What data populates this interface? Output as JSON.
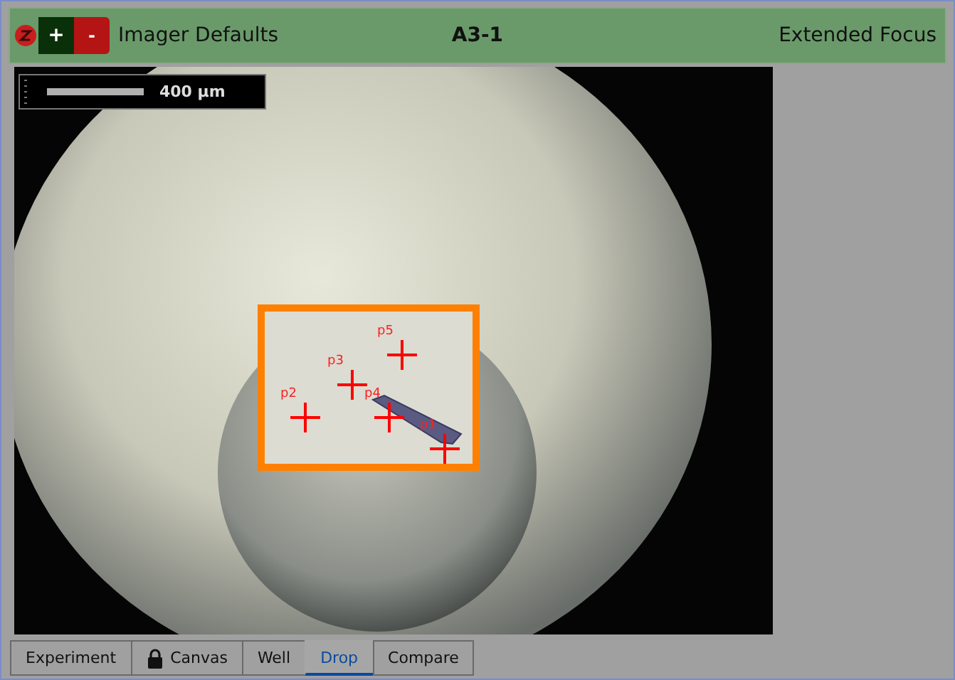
{
  "header": {
    "zoom_in": "+",
    "zoom_out": "-",
    "left_label": "Imager Defaults",
    "title": "A3-1",
    "right_label": "Extended Focus"
  },
  "scale_bar": {
    "label": "400 µm"
  },
  "points": [
    {
      "label": "p1"
    },
    {
      "label": "p2"
    },
    {
      "label": "p3"
    },
    {
      "label": "p4"
    },
    {
      "label": "p5"
    }
  ],
  "tabs": [
    {
      "label": "Experiment",
      "selected": false,
      "locked": false
    },
    {
      "label": "Canvas",
      "selected": false,
      "locked": true
    },
    {
      "label": "Well",
      "selected": false,
      "locked": false
    },
    {
      "label": "Drop",
      "selected": true,
      "locked": false
    },
    {
      "label": "Compare",
      "selected": false,
      "locked": false
    }
  ]
}
